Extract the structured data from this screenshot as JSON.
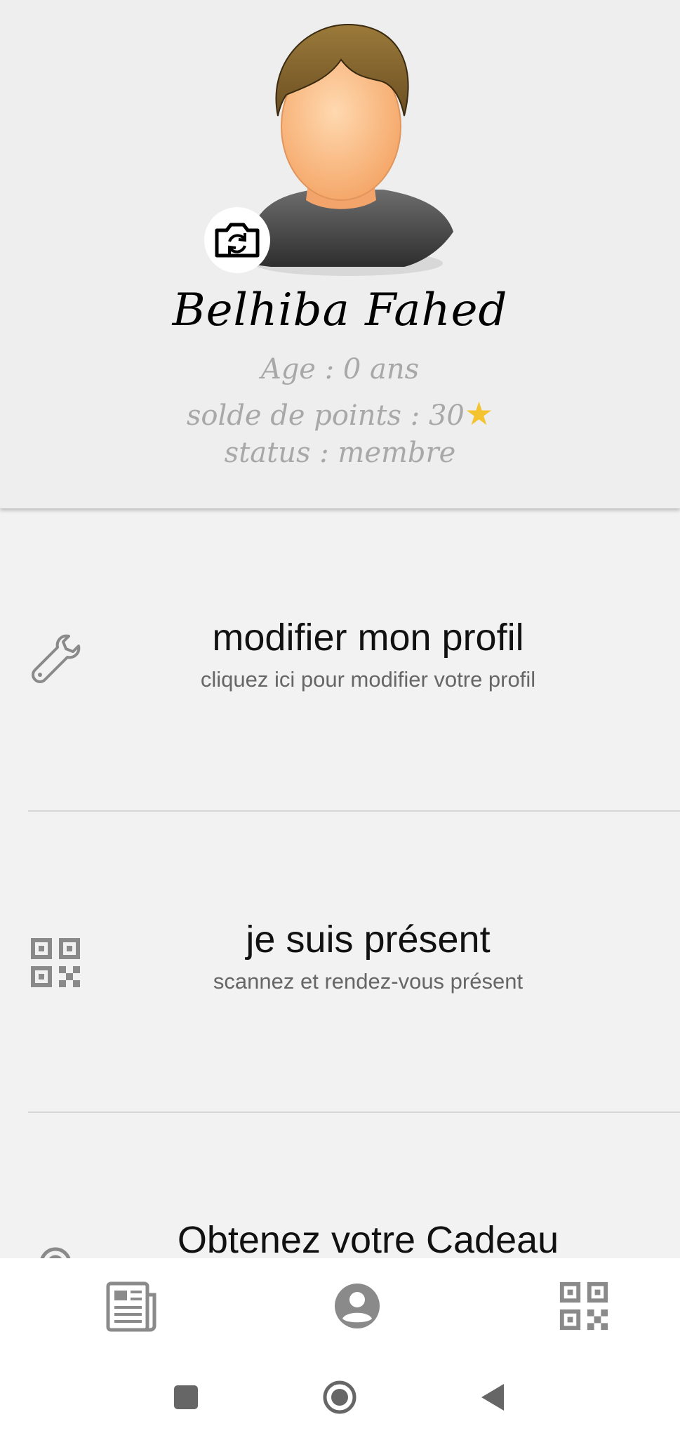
{
  "profile": {
    "name": "Belhiba Fahed",
    "age": "Age : 0 ans",
    "points": "solde de points : 30",
    "points_icon": "star-icon",
    "status": "status : membre"
  },
  "menu": [
    {
      "icon": "wrench-icon",
      "title": "modifier mon profil",
      "subtitle": "cliquez ici pour modifier votre profil"
    },
    {
      "icon": "qr-code-icon",
      "title": "je suis présent",
      "subtitle": "scannez et rendez-vous présent"
    },
    {
      "icon": "target-icon",
      "title": "Obtenez votre Cadeau"
    }
  ],
  "bottom_nav": [
    "news-icon",
    "account-icon",
    "qr-code-icon"
  ],
  "system_nav": [
    "recents-icon",
    "home-icon",
    "back-icon"
  ],
  "colors": {
    "header_bg": "#eeeeee",
    "page_bg": "#f2f2f2",
    "icon_gray": "#8a8a8a",
    "star": "#f4c430"
  }
}
